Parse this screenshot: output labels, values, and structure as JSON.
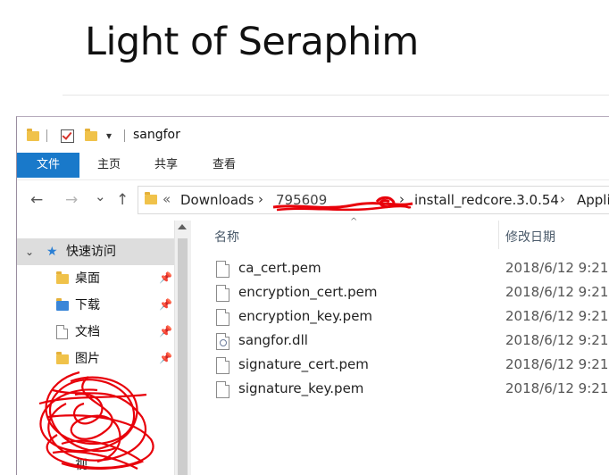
{
  "page": {
    "title": "Light of Seraphim"
  },
  "window": {
    "title": "sangfor",
    "quick_access_dropdown": "▾"
  },
  "ribbon": {
    "tabs": [
      {
        "label": "文件",
        "active": true
      },
      {
        "label": "主页",
        "active": false
      },
      {
        "label": "共享",
        "active": false
      },
      {
        "label": "查看",
        "active": false
      }
    ]
  },
  "nav": {
    "back": "←",
    "forward": "→",
    "recent": "⌄",
    "up": "↑",
    "overflow": "«",
    "breadcrumbs": [
      "Downloads",
      "795609",
      "install_redcore.3.0.54",
      "Appli"
    ]
  },
  "sidebar": {
    "quick_access_label": "快速访问",
    "items": [
      {
        "label": "桌面",
        "icon": "desktop-folder-icon"
      },
      {
        "label": "下载",
        "icon": "downloads-folder-icon"
      },
      {
        "label": "文档",
        "icon": "documents-folder-icon"
      },
      {
        "label": "图片",
        "icon": "pictures-folder-icon"
      }
    ],
    "partial_label": "视"
  },
  "file_list": {
    "columns": {
      "name": "名称",
      "modified": "修改日期"
    },
    "files": [
      {
        "name": "ca_cert.pem",
        "date": "2018/6/12 9:21",
        "icon": "file-icon"
      },
      {
        "name": "encryption_cert.pem",
        "date": "2018/6/12 9:21",
        "icon": "file-icon"
      },
      {
        "name": "encryption_key.pem",
        "date": "2018/6/12 9:21",
        "icon": "file-icon"
      },
      {
        "name": "sangfor.dll",
        "date": "2018/6/12 9:21",
        "icon": "dll-file-icon"
      },
      {
        "name": "signature_cert.pem",
        "date": "2018/6/12 9:21",
        "icon": "file-icon"
      },
      {
        "name": "signature_key.pem",
        "date": "2018/6/12 9:21",
        "icon": "file-icon"
      }
    ]
  },
  "colors": {
    "accent": "#1979ca",
    "redaction": "#e8000a",
    "folder": "#f0c24a"
  }
}
